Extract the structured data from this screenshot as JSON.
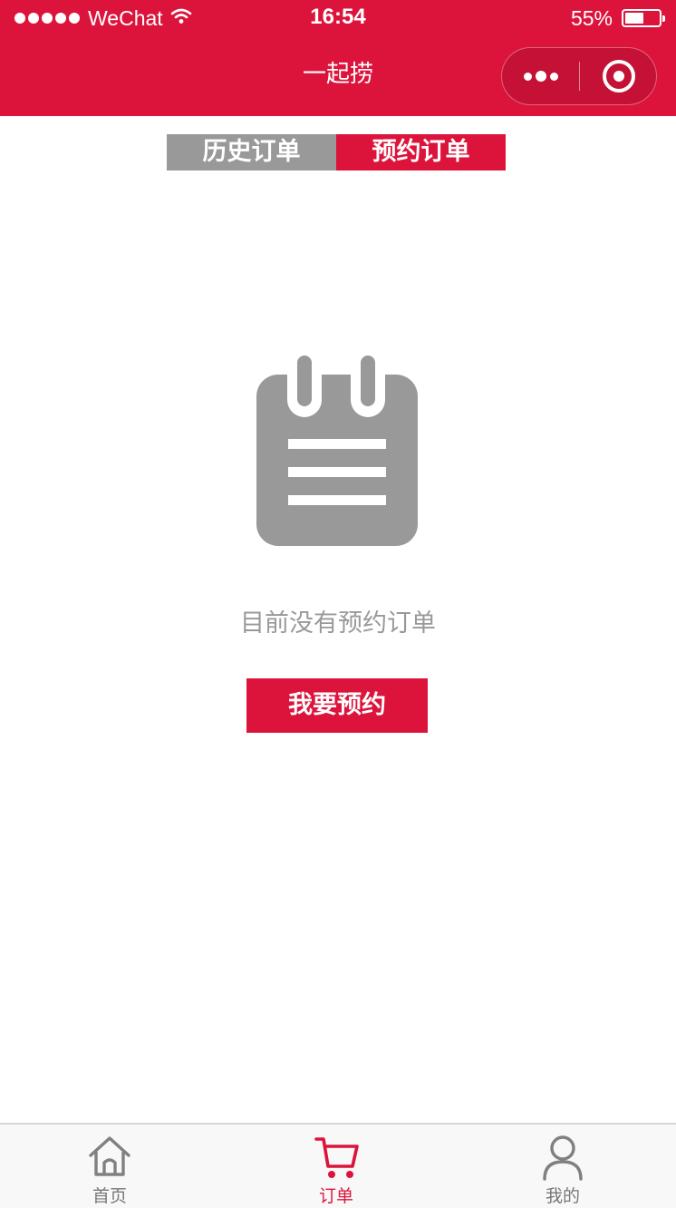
{
  "status_bar": {
    "carrier": "WeChat",
    "time": "16:54",
    "battery_percent": "55%",
    "battery_level": 0.55,
    "signal_bars": 5,
    "icons": [
      "signal-dots-icon",
      "wifi-icon",
      "battery-icon"
    ]
  },
  "nav": {
    "title": "一起捞",
    "capsule_icons": [
      "more-dots-icon",
      "close-circle-icon"
    ]
  },
  "tabs": [
    {
      "label": "历史订单",
      "active": false
    },
    {
      "label": "预约订单",
      "active": true
    }
  ],
  "empty_state": {
    "icon": "notepad-icon",
    "message": "目前没有预约订单",
    "button_label": "我要预约"
  },
  "tabbar": {
    "items": [
      {
        "label": "首页",
        "icon": "home-icon",
        "active": false
      },
      {
        "label": "订单",
        "icon": "cart-icon",
        "active": true
      },
      {
        "label": "我的",
        "icon": "user-icon",
        "active": false
      }
    ]
  },
  "colors": {
    "primary": "#DC143C",
    "inactive_tab": "#999999",
    "muted_text": "#999999",
    "icon_gray": "#999999",
    "tabbar_background": "#f8f8f8"
  }
}
